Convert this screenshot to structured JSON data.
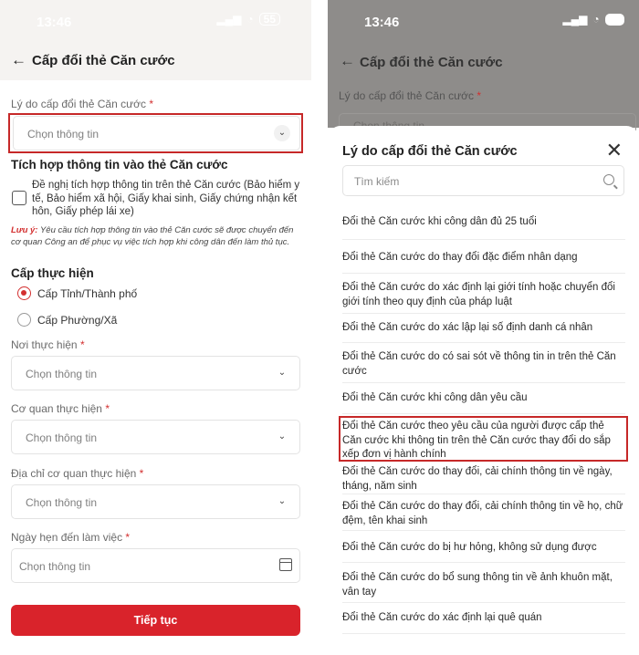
{
  "left": {
    "status": {
      "time": "13:46",
      "battery": "55"
    },
    "header": {
      "back": "←",
      "title": "Cấp đổi thẻ Căn cước"
    },
    "reason": {
      "label": "Lý do cấp đổi thẻ Căn cước",
      "required": "*",
      "placeholder": "Chọn thông tin"
    },
    "integration": {
      "title": "Tích hợp thông tin vào thẻ Căn cước",
      "checkbox_label": "Đề nghị tích hợp thông tin trên thẻ Căn cước (Bảo hiểm y tế, Bảo hiểm xã hội, Giấy khai sinh, Giấy chứng nhận kết hôn, Giấy phép lái xe)",
      "note_prefix": "Lưu ý:",
      "note_text": "Yêu cầu tích hợp thông tin vào thẻ Căn cước sẽ được chuyển đến cơ quan Công an để phục vụ việc tích hợp khi công dân đến làm thủ tục."
    },
    "level": {
      "title": "Cấp thực hiện",
      "options": [
        {
          "label": "Cấp Tỉnh/Thành phố",
          "selected": true
        },
        {
          "label": "Cấp Phường/Xã",
          "selected": false
        }
      ]
    },
    "fields": [
      {
        "label": "Nơi thực hiện",
        "required": "*",
        "placeholder": "Chọn thông tin"
      },
      {
        "label": "Cơ quan thực hiện",
        "required": "*",
        "placeholder": "Chọn thông tin"
      },
      {
        "label": "Địa chỉ cơ quan thực hiện",
        "required": "*",
        "placeholder": "Chọn thông tin"
      },
      {
        "label": "Ngày hẹn đến làm việc",
        "required": "*",
        "placeholder": "Chọn thông tin"
      }
    ],
    "submit_label": "Tiếp tục",
    "icons": {
      "chevron": "chevron-down-icon",
      "calendar": "calendar-icon",
      "back": "arrow-left-icon"
    }
  },
  "right": {
    "status": {
      "time": "13:46",
      "battery": "55"
    },
    "header": {
      "back": "←",
      "title": "Cấp đổi thẻ Căn cước"
    },
    "bg_label": "Lý do cấp đổi thẻ Căn cước",
    "bg_required": "*",
    "bg_placeholder": "Chọn thông tin",
    "sheet": {
      "title": "Lý do cấp đổi thẻ Căn cước",
      "close": "✕",
      "search_placeholder": "Tìm kiếm",
      "options": [
        "Đổi thẻ Căn cước khi công dân đủ 25 tuổi",
        "Đổi thẻ Căn cước do thay đổi đặc điểm nhân dạng",
        "Đổi thẻ Căn cước do xác định lại giới tính hoặc chuyển đổi giới tính theo quy định của pháp luật",
        "Đổi thẻ Căn cước do xác lập lại số định danh cá nhân",
        "Đổi thẻ Căn cước do có sai sót về thông tin in trên thẻ Căn cước",
        "Đổi thẻ Căn cước khi công dân yêu cầu",
        "Đổi thẻ Căn cước theo yêu cầu của người được cấp thẻ Căn cước khi thông tin trên thẻ Căn cước thay đổi do sắp xếp đơn vị hành chính",
        "Đổi thẻ Căn cước do thay đổi, cải chính thông tin về ngày, tháng, năm sinh",
        "Đổi thẻ Căn cước do thay đổi, cải chính thông tin về họ, chữ đệm, tên khai sinh",
        "Đổi thẻ Căn cước do bị hư hỏng, không sử dụng được",
        "Đổi thẻ Căn cước do bổ sung thông tin về ảnh khuôn mặt, vân tay",
        "Đổi thẻ Căn cước do xác định lại quê quán"
      ]
    },
    "colors": {
      "accent": "#d9232b",
      "highlight": "#c62828"
    }
  }
}
